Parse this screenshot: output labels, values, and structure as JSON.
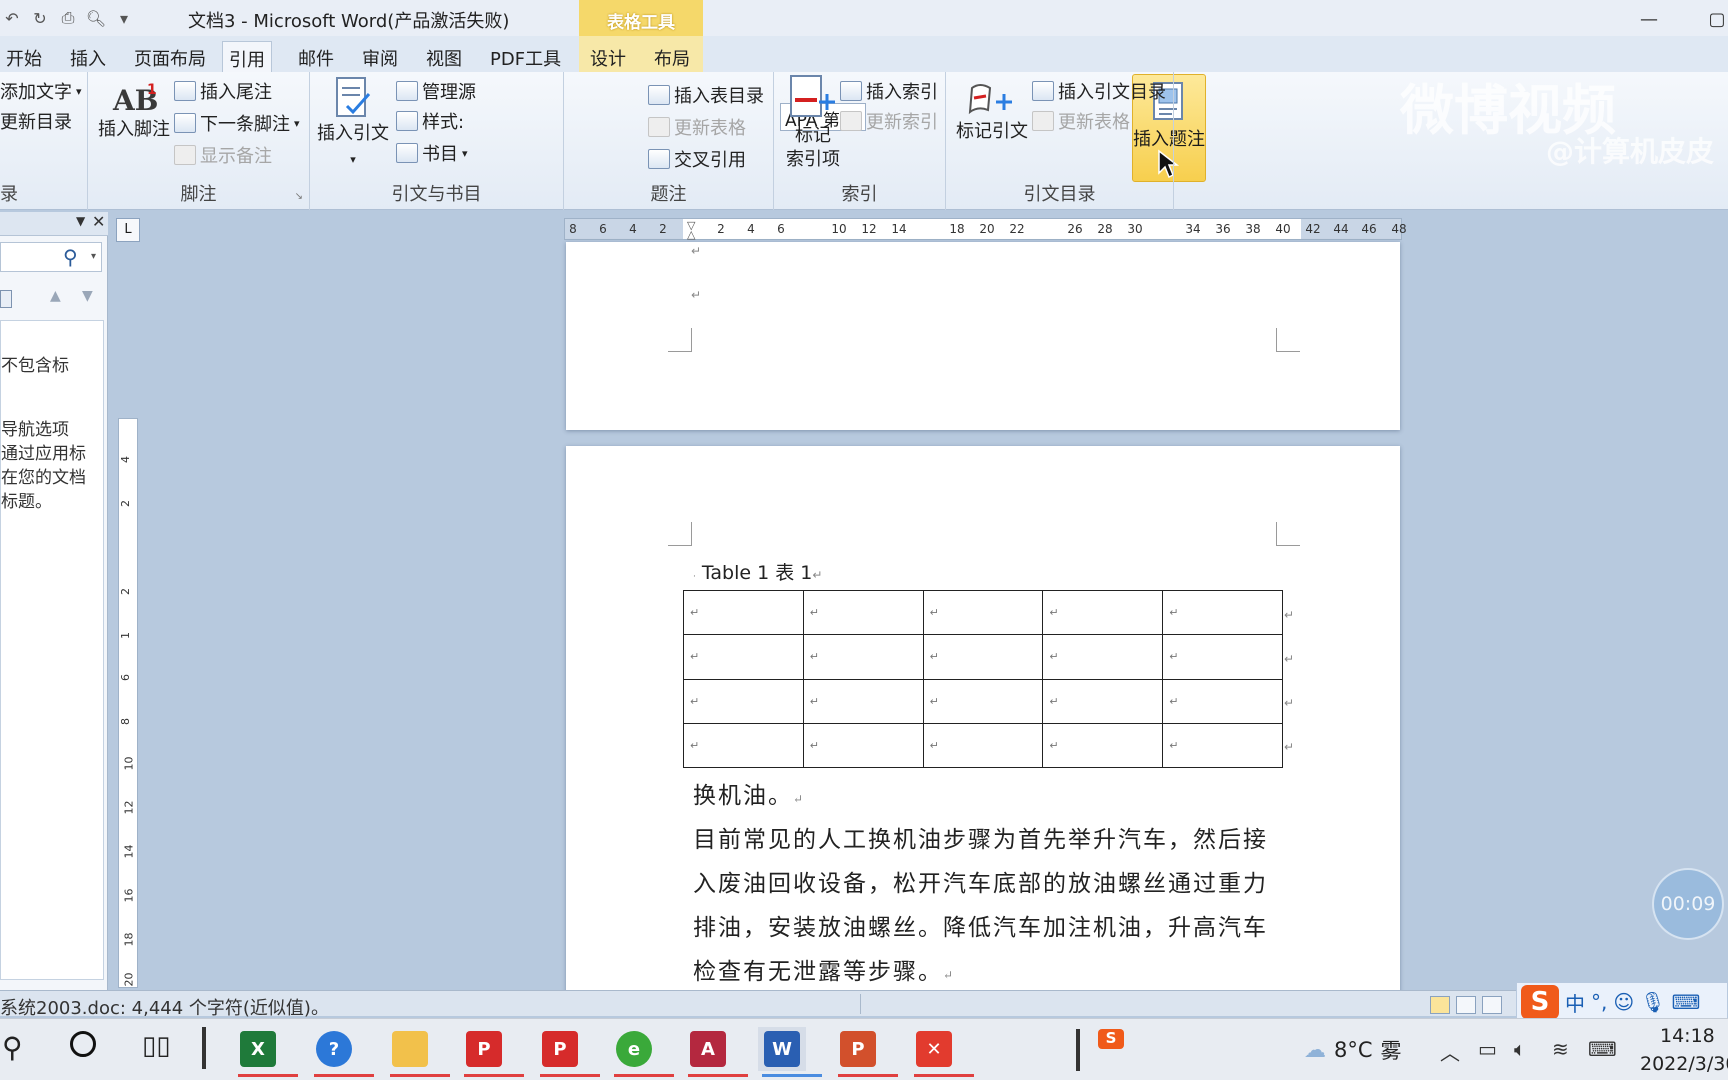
{
  "title_bar": {
    "doc_title": "文档3 - Microsoft Word(产品激活失败)",
    "context_tab_group": "表格工具"
  },
  "tabs": [
    "开始",
    "插入",
    "页面布局",
    "引用",
    "邮件",
    "审阅",
    "视图",
    "PDF工具",
    "设计",
    "布局"
  ],
  "active_tab": "引用",
  "ribbon": {
    "toc_group": {
      "add_text": "添加文字",
      "update_toc": "更新目录",
      "label": "录"
    },
    "footnotes": {
      "insert_footnote": "插入脚注",
      "insert_endnote": "插入尾注",
      "next_footnote": "下一条脚注",
      "show_notes": "显示备注",
      "label": "脚注"
    },
    "citations": {
      "insert_citation": "插入引文",
      "manage_sources": "管理源",
      "style_label": "样式:",
      "style_value": "APA 第五",
      "bibliography": "书目",
      "label": "引文与书目"
    },
    "captions": {
      "insert_caption": "插入题注",
      "insert_table_of_figures": "插入表目录",
      "update_table": "更新表格",
      "cross_reference": "交叉引用",
      "label": "题注"
    },
    "index": {
      "mark_entry_line1": "标记",
      "mark_entry_line2": "索引项",
      "insert_index": "插入索引",
      "update_index": "更新索引",
      "label": "索引"
    },
    "table_of_authorities": {
      "mark_citation": "标记引文",
      "insert_toa": "插入引文目录",
      "update_table": "更新表格",
      "label": "引文目录"
    },
    "watermark_main": "微博视频",
    "watermark_sub": "@计算机皮皮"
  },
  "nav_pane": {
    "text_lines": [
      "不包含标",
      "导航选项",
      "通过应用标",
      "在您的文档",
      "标题。"
    ]
  },
  "ruler": {
    "corner": "L",
    "h_ticks": [
      "8",
      "6",
      "4",
      "2",
      "2",
      "4",
      "6",
      "10",
      "12",
      "14",
      "18",
      "20",
      "22",
      "26",
      "28",
      "30",
      "34",
      "36",
      "38",
      "40",
      "42",
      "44",
      "46",
      "48"
    ],
    "v_ticks": [
      "4",
      "2",
      "2",
      "1",
      "6",
      "8",
      "10",
      "12",
      "14",
      "16",
      "18",
      "20"
    ]
  },
  "document": {
    "caption": "Table 1 表 1",
    "table": {
      "rows": 4,
      "cols": 5
    },
    "para1": "换机油。",
    "para2_lines": [
      "目前常见的人工换机油步骤为首先举升汽车，然后接",
      "入废油回收设备，松开汽车底部的放油螺丝通过重力",
      "排油，安装放油螺丝。降低汽车加注机油，升高汽车",
      "检查有无泄露等步骤。"
    ],
    "return_mark": "↵"
  },
  "status_bar": {
    "text": "系统2003.doc: 4,444 个字符(近似值)。"
  },
  "timer_overlay": "00:09",
  "ime": {
    "lang": "中",
    "punct": "°,"
  },
  "taskbar": {
    "weather_temp": "8°C",
    "weather_desc": "雾",
    "time": "14:18",
    "date": "2022/3/30"
  }
}
